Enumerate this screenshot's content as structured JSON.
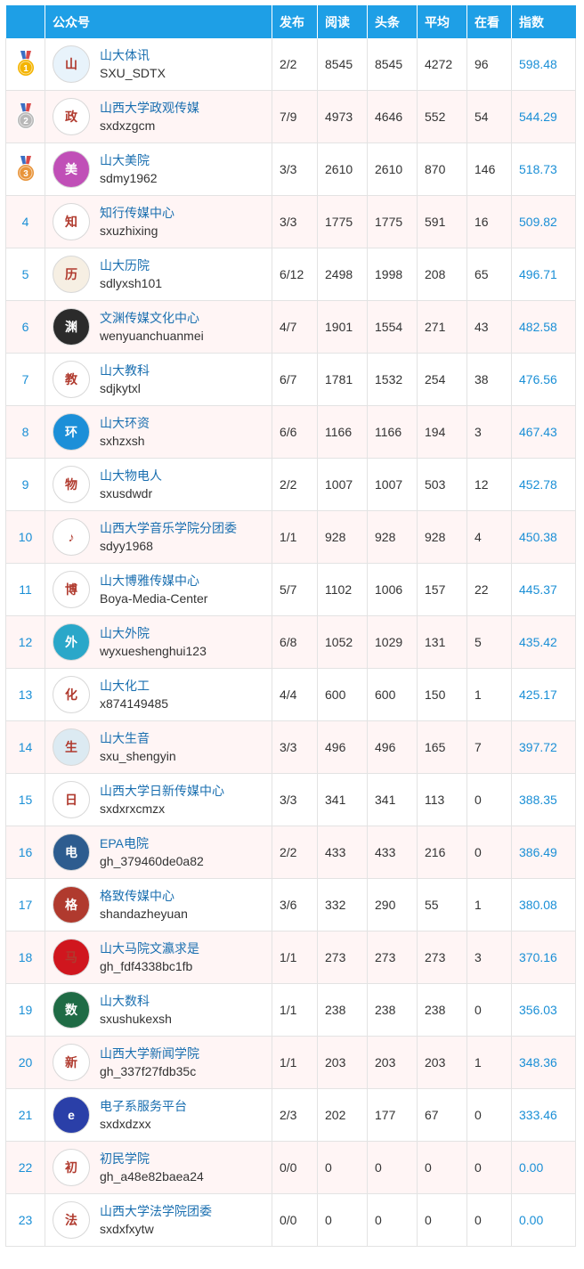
{
  "header": {
    "blank": "",
    "account": "公众号",
    "publish": "发布",
    "reads": "阅读",
    "headline": "头条",
    "average": "平均",
    "watching": "在看",
    "index": "指数"
  },
  "colors": {
    "header_bg": "#1e9fe6",
    "row_alt": "#fff5f5",
    "link": "#1a6fb0",
    "index_text": "#1a8fd6",
    "medal_gold": "#f4b400",
    "medal_silver": "#b8b8b8",
    "medal_bronze": "#e8943a",
    "ribbon": "#3b6fc4"
  },
  "rows": [
    {
      "rank": "1",
      "medal": "gold",
      "name": "山大体讯",
      "id": "SXU_SDTX",
      "publish": "2/2",
      "reads": "8545",
      "headline": "8545",
      "avg": "4272",
      "watch": "96",
      "index": "598.48",
      "avatar_color": "#e8f3fb",
      "avatar_icon": "campus-emblem-icon",
      "avatar_char": "山"
    },
    {
      "rank": "2",
      "medal": "silver",
      "name": "山西大学政观传媒",
      "id": "sxdxzgcm",
      "publish": "7/9",
      "reads": "4973",
      "headline": "4646",
      "avg": "552",
      "watch": "54",
      "index": "544.29",
      "avatar_color": "#ffffff",
      "avatar_icon": "calligraphy-logo-icon",
      "avatar_char": "政"
    },
    {
      "rank": "3",
      "medal": "bronze",
      "name": "山大美院",
      "id": "sdmy1962",
      "publish": "3/3",
      "reads": "2610",
      "headline": "2610",
      "avg": "870",
      "watch": "146",
      "index": "518.73",
      "avatar_color": "#c04fb7",
      "avatar_icon": "colorful-logo-icon",
      "avatar_char": "美"
    },
    {
      "rank": "4",
      "medal": "",
      "name": "知行传媒中心",
      "id": "sxuzhixing",
      "publish": "3/3",
      "reads": "1775",
      "headline": "1775",
      "avg": "591",
      "watch": "16",
      "index": "509.82",
      "avatar_color": "#ffffff",
      "avatar_icon": "leaf-logo-icon",
      "avatar_char": "知"
    },
    {
      "rank": "5",
      "medal": "",
      "name": "山大历院",
      "id": "sdlyxsh101",
      "publish": "6/12",
      "reads": "2498",
      "headline": "1998",
      "avg": "208",
      "watch": "65",
      "index": "496.71",
      "avatar_color": "#f6efe3",
      "avatar_icon": "building-emblem-icon",
      "avatar_char": "历"
    },
    {
      "rank": "6",
      "medal": "",
      "name": "文渊传媒文化中心",
      "id": "wenyuanchuanmei",
      "publish": "4/7",
      "reads": "1901",
      "headline": "1554",
      "avg": "271",
      "watch": "43",
      "index": "482.58",
      "avatar_color": "#2b2b2b",
      "avatar_icon": "ink-logo-icon",
      "avatar_char": "渊"
    },
    {
      "rank": "7",
      "medal": "",
      "name": "山大教科",
      "id": "sdjkytxl",
      "publish": "6/7",
      "reads": "1781",
      "headline": "1532",
      "avg": "254",
      "watch": "38",
      "index": "476.56",
      "avatar_color": "#ffffff",
      "avatar_icon": "red-seal-icon",
      "avatar_char": "教"
    },
    {
      "rank": "8",
      "medal": "",
      "name": "山大环资",
      "id": "sxhzxsh",
      "publish": "6/6",
      "reads": "1166",
      "headline": "1166",
      "avg": "194",
      "watch": "3",
      "index": "467.43",
      "avatar_color": "#1c8fd8",
      "avatar_icon": "wave-logo-icon",
      "avatar_char": "环"
    },
    {
      "rank": "9",
      "medal": "",
      "name": "山大物电人",
      "id": "sxusdwdr",
      "publish": "2/2",
      "reads": "1007",
      "headline": "1007",
      "avg": "503",
      "watch": "12",
      "index": "452.78",
      "avatar_color": "#ffffff",
      "avatar_icon": "blue-emblem-icon",
      "avatar_char": "物"
    },
    {
      "rank": "10",
      "medal": "",
      "name": "山西大学音乐学院分团委",
      "id": "sdyy1968",
      "publish": "1/1",
      "reads": "928",
      "headline": "928",
      "avg": "928",
      "watch": "4",
      "index": "450.38",
      "avatar_color": "#ffffff",
      "avatar_icon": "music-logo-icon",
      "avatar_char": "♪"
    },
    {
      "rank": "11",
      "medal": "",
      "name": "山大博雅传媒中心",
      "id": "Boya-Media-Center",
      "publish": "5/7",
      "reads": "1102",
      "headline": "1006",
      "avg": "157",
      "watch": "22",
      "index": "445.37",
      "avatar_color": "#ffffff",
      "avatar_icon": "swirl-logo-icon",
      "avatar_char": "博"
    },
    {
      "rank": "12",
      "medal": "",
      "name": "山大外院",
      "id": "wyxueshenghui123",
      "publish": "6/8",
      "reads": "1052",
      "headline": "1029",
      "avg": "131",
      "watch": "5",
      "index": "435.42",
      "avatar_color": "#2aa7c9",
      "avatar_icon": "globe-logo-icon",
      "avatar_char": "外"
    },
    {
      "rank": "13",
      "medal": "",
      "name": "山大化工",
      "id": "x874149485",
      "publish": "4/4",
      "reads": "600",
      "headline": "600",
      "avg": "150",
      "watch": "1",
      "index": "425.17",
      "avatar_color": "#ffffff",
      "avatar_icon": "flask-logo-icon",
      "avatar_char": "化"
    },
    {
      "rank": "14",
      "medal": "",
      "name": "山大生音",
      "id": "sxu_shengyin",
      "publish": "3/3",
      "reads": "496",
      "headline": "496",
      "avg": "165",
      "watch": "7",
      "index": "397.72",
      "avatar_color": "#dceaf2",
      "avatar_icon": "butterfly-logo-icon",
      "avatar_char": "生"
    },
    {
      "rank": "15",
      "medal": "",
      "name": "山西大学日新传媒中心",
      "id": "sxdxrxcmzx",
      "publish": "3/3",
      "reads": "341",
      "headline": "341",
      "avg": "113",
      "watch": "0",
      "index": "388.35",
      "avatar_color": "#ffffff",
      "avatar_icon": "pattern-logo-icon",
      "avatar_char": "日"
    },
    {
      "rank": "16",
      "medal": "",
      "name": "EPA电院",
      "id": "gh_379460de0a82",
      "publish": "2/2",
      "reads": "433",
      "headline": "433",
      "avg": "216",
      "watch": "0",
      "index": "386.49",
      "avatar_color": "#2d5c8f",
      "avatar_icon": "university-seal-icon",
      "avatar_char": "电"
    },
    {
      "rank": "17",
      "medal": "",
      "name": "格致传媒中心",
      "id": "shandazheyuan",
      "publish": "3/6",
      "reads": "332",
      "headline": "290",
      "avg": "55",
      "watch": "1",
      "index": "380.08",
      "avatar_color": "#b03a2e",
      "avatar_icon": "red-circle-logo-icon",
      "avatar_char": "格"
    },
    {
      "rank": "18",
      "medal": "",
      "name": "山大马院文瀛求是",
      "id": "gh_fdf4338bc1fb",
      "publish": "1/1",
      "reads": "273",
      "headline": "273",
      "avg": "273",
      "watch": "3",
      "index": "370.16",
      "avatar_color": "#d0161e",
      "avatar_icon": "red-cube-logo-icon",
      "avatar_char": "马"
    },
    {
      "rank": "19",
      "medal": "",
      "name": "山大数科",
      "id": "sxushukexsh",
      "publish": "1/1",
      "reads": "238",
      "headline": "238",
      "avg": "238",
      "watch": "0",
      "index": "356.03",
      "avatar_color": "#1f6b45",
      "avatar_icon": "green-seal-icon",
      "avatar_char": "数"
    },
    {
      "rank": "20",
      "medal": "",
      "name": "山西大学新闻学院",
      "id": "gh_337f27fdb35c",
      "publish": "1/1",
      "reads": "203",
      "headline": "203",
      "avg": "203",
      "watch": "1",
      "index": "348.36",
      "avatar_color": "#ffffff",
      "avatar_icon": "script-logo-icon",
      "avatar_char": "新"
    },
    {
      "rank": "21",
      "medal": "",
      "name": "电子系服务平台",
      "id": "sxdxdzxx",
      "publish": "2/3",
      "reads": "202",
      "headline": "177",
      "avg": "67",
      "watch": "0",
      "index": "333.46",
      "avatar_color": "#2a3fa8",
      "avatar_icon": "e-logo-icon",
      "avatar_char": "e"
    },
    {
      "rank": "22",
      "medal": "",
      "name": "初民学院",
      "id": "gh_a48e82baea24",
      "publish": "0/0",
      "reads": "0",
      "headline": "0",
      "avg": "0",
      "watch": "0",
      "index": "0.00",
      "avatar_color": "#ffffff",
      "avatar_icon": "red-seal-icon",
      "avatar_char": "初"
    },
    {
      "rank": "23",
      "medal": "",
      "name": "山西大学法学院团委",
      "id": "sxdxfxytw",
      "publish": "0/0",
      "reads": "0",
      "headline": "0",
      "avg": "0",
      "watch": "0",
      "index": "0.00",
      "avatar_color": "#ffffff",
      "avatar_icon": "emblem-icon",
      "avatar_char": "法"
    }
  ]
}
